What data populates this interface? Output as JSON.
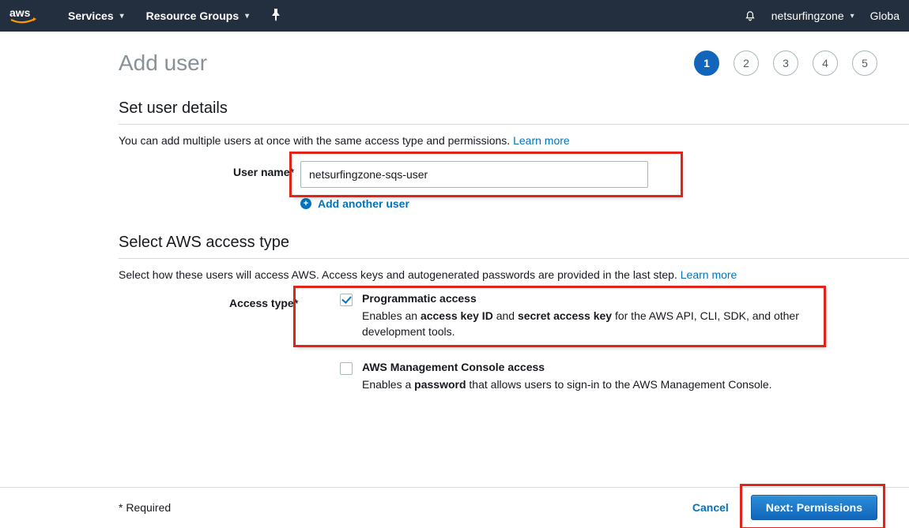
{
  "nav": {
    "services": "Services",
    "resource_groups": "Resource Groups",
    "account": "netsurfingzone",
    "region": "Globa"
  },
  "wizard": {
    "steps": [
      "1",
      "2",
      "3",
      "4",
      "5"
    ],
    "active_index": 0
  },
  "page": {
    "title": "Add user"
  },
  "user_details": {
    "heading": "Set user details",
    "desc_prefix": "You can add multiple users at once with the same access type and permissions. ",
    "learn_more": "Learn more",
    "username_label": "User name*",
    "username_value": "netsurfingzone-sqs-user",
    "add_another": "Add another user"
  },
  "access_type": {
    "heading": "Select AWS access type",
    "desc_prefix": "Select how these users will access AWS. Access keys and autogenerated passwords are provided in the last step. ",
    "learn_more": "Learn more",
    "label": "Access type*",
    "options": [
      {
        "title": "Programmatic access",
        "desc_pre": "Enables an ",
        "bold1": "access key ID",
        "desc_mid": " and ",
        "bold2": "secret access key",
        "desc_post": " for the AWS API, CLI, SDK, and other development tools.",
        "checked": true
      },
      {
        "title": "AWS Management Console access",
        "desc_pre": "Enables a ",
        "bold1": "password",
        "desc_mid": "",
        "bold2": "",
        "desc_post": " that allows users to sign-in to the AWS Management Console.",
        "checked": false
      }
    ]
  },
  "footer": {
    "required": "* Required",
    "cancel": "Cancel",
    "next": "Next: Permissions"
  }
}
